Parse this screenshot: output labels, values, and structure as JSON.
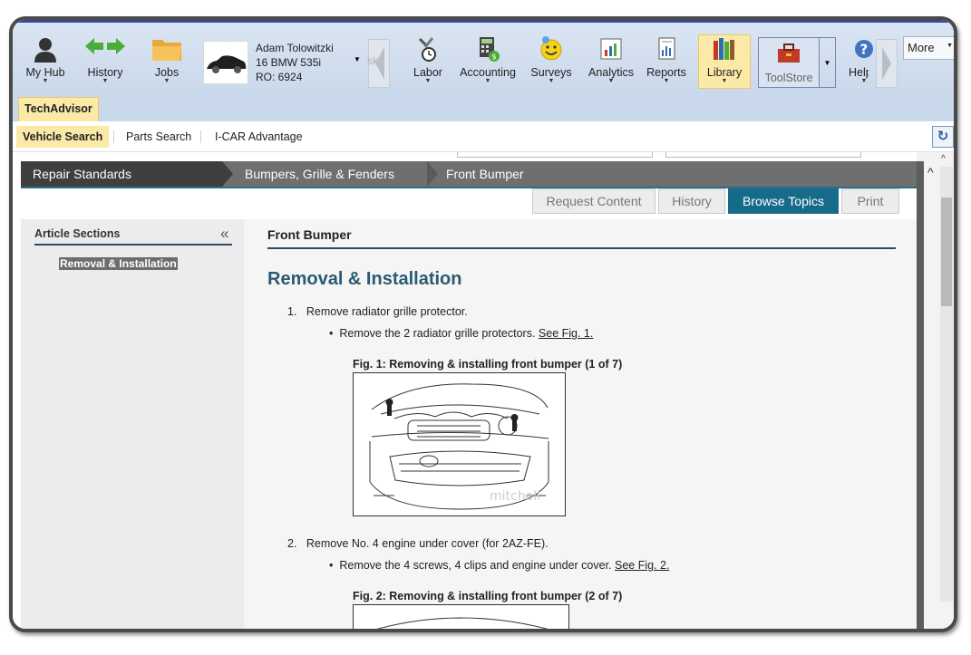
{
  "toolbar": {
    "items": [
      {
        "label": "My Hub",
        "icon": "person-icon"
      },
      {
        "label": "History",
        "icon": "arrows-icon"
      },
      {
        "label": "Jobs",
        "icon": "folder-icon"
      },
      {
        "label": "Labor",
        "icon": "tools-clock-icon"
      },
      {
        "label": "Accounting",
        "icon": "calculator-money-icon"
      },
      {
        "label": "Surveys",
        "icon": "smiley-icon"
      },
      {
        "label": "Analytics",
        "icon": "chart-icon"
      },
      {
        "label": "Reports",
        "icon": "report-icon"
      },
      {
        "label": "Library",
        "icon": "books-icon"
      },
      {
        "label": "ToolStore",
        "icon": "toolbox-icon"
      },
      {
        "label": "Help",
        "icon": "help-icon"
      }
    ],
    "clipped_label": "sks",
    "more_label": "More",
    "active": "Library"
  },
  "vehicle": {
    "customer": "Adam Tolowitzki",
    "model": "16 BMW 535i",
    "ro": "RO: 6924",
    "icon": "car-icon"
  },
  "tabs": {
    "main": "TechAdvisor",
    "sub": [
      "Vehicle Search",
      "Parts Search",
      "I-CAR Advantage"
    ],
    "active_sub": "Vehicle Search"
  },
  "breadcrumb": [
    "Repair Standards",
    "Bumpers, Grille & Fenders",
    "Front Bumper"
  ],
  "actions": [
    "Request Content",
    "History",
    "Browse Topics",
    "Print"
  ],
  "sidebar": {
    "title": "Article Sections",
    "collapse_icon": "double-chevron-left-icon",
    "link": "Removal & Installation"
  },
  "article": {
    "title": "Front Bumper",
    "heading": "Removal & Installation",
    "steps": [
      {
        "number": "1.",
        "text": "Remove radiator grille protector.",
        "bullet": "Remove the 2 radiator grille protectors.",
        "link": "See Fig. 1.",
        "figure_caption": "Fig. 1: Removing & installing front bumper (1 of 7)"
      },
      {
        "number": "2.",
        "text": "Remove No. 4 engine under cover (for 2AZ-FE).",
        "bullet": "Remove the 4 screws, 4 clips and engine under cover.",
        "link": "See Fig. 2.",
        "figure_caption": "Fig. 2: Removing & installing front bumper (2 of 7)"
      }
    ],
    "watermark": "mitchell"
  }
}
